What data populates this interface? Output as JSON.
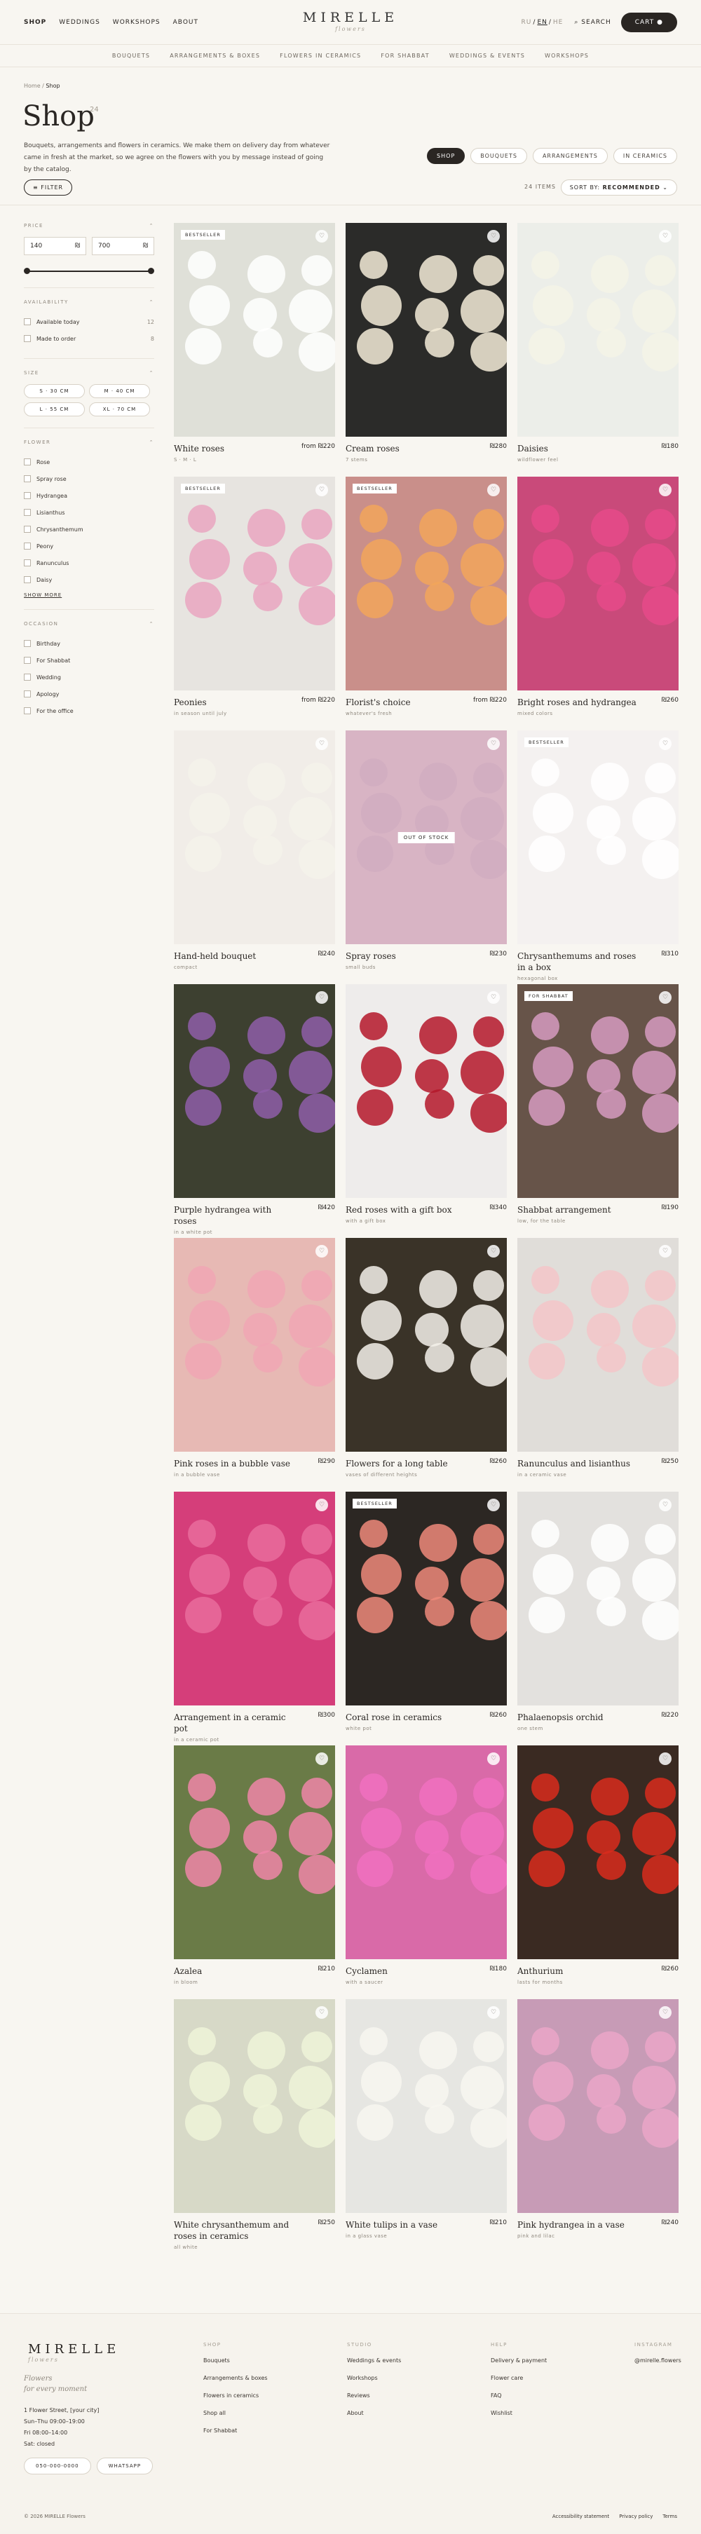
{
  "header": {
    "nav": [
      "SHOP",
      "WEDDINGS",
      "WORKSHOPS",
      "ABOUT"
    ],
    "logo": "MIRELLE",
    "logo_sub": "flowers",
    "lang": [
      "RU",
      "EN",
      "HE"
    ],
    "search": "SEARCH",
    "cart": "CART"
  },
  "categories": [
    "BOUQUETS",
    "ARRANGEMENTS & BOXES",
    "FLOWERS IN CERAMICS",
    "FOR SHABBAT",
    "WEDDINGS & EVENTS",
    "WORKSHOPS"
  ],
  "breadcrumb": {
    "home": "Home",
    "sep": "/",
    "current": "Shop"
  },
  "page": {
    "title": "Shop",
    "count": "24",
    "intro": "Bouquets, arrangements and flowers in ceramics. We make them on delivery day from whatever came in fresh at the market, so we agree on the flowers with you by message instead of going by the catalog."
  },
  "tabs": [
    "SHOP",
    "BOUQUETS",
    "ARRANGEMENTS",
    "IN CERAMICS"
  ],
  "toolbar": {
    "filter": "FILTER",
    "items": "24 ITEMS",
    "sort_label": "SORT BY:",
    "sort_value": "RECOMMENDED"
  },
  "filters": {
    "price": {
      "title": "PRICE",
      "min": "140",
      "max": "700",
      "cur": "₪",
      "min_val": 140,
      "max_val": 700
    },
    "availability": {
      "title": "AVAILABILITY",
      "options": [
        {
          "label": "Available today",
          "count": "12"
        },
        {
          "label": "Made to order",
          "count": "8"
        }
      ]
    },
    "size": {
      "title": "SIZE",
      "options": [
        "S · 30 CM",
        "M · 40 CM",
        "L · 55 CM",
        "XL · 70 CM"
      ]
    },
    "flower": {
      "title": "FLOWER",
      "options": [
        "Rose",
        "Spray rose",
        "Hydrangea",
        "Lisianthus",
        "Chrysanthemum",
        "Peony",
        "Ranunculus",
        "Daisy"
      ],
      "more": "SHOW MORE"
    },
    "occasion": {
      "title": "OCCASION",
      "options": [
        "Birthday",
        "For Shabbat",
        "Wedding",
        "Apology",
        "For the office"
      ]
    }
  },
  "products": [
    {
      "name": "White roses",
      "price": "from ₪220",
      "desc": "S · M · L",
      "badge": "BESTSELLER"
    },
    {
      "name": "Cream roses",
      "price": "₪280",
      "desc": "7 stems",
      "badge": ""
    },
    {
      "name": "Daisies",
      "price": "₪180",
      "desc": "wildflower feel",
      "badge": ""
    },
    {
      "name": "Peonies",
      "price": "from ₪220",
      "desc": "in season until july",
      "badge": "BESTSELLER"
    },
    {
      "name": "Florist's choice",
      "price": "from ₪220",
      "desc": "whatever's fresh",
      "badge": "BESTSELLER"
    },
    {
      "name": "Bright roses and hydrangea",
      "price": "₪260",
      "desc": "mixed colors",
      "badge": ""
    },
    {
      "name": "Hand-held bouquet",
      "price": "₪240",
      "desc": "compact",
      "badge": ""
    },
    {
      "name": "Spray roses",
      "price": "₪230",
      "desc": "small buds",
      "badge": "",
      "oos": "OUT OF STOCK"
    },
    {
      "name": "Chrysanthemums and roses in a box",
      "price": "₪310",
      "desc": "hexagonal box",
      "badge": "BESTSELLER"
    },
    {
      "name": "Purple hydrangea with roses",
      "price": "₪420",
      "desc": "in a white pot",
      "badge": ""
    },
    {
      "name": "Red roses with a gift box",
      "price": "₪340",
      "desc": "with a gift box",
      "badge": ""
    },
    {
      "name": "Shabbat arrangement",
      "price": "₪190",
      "desc": "low, for the table",
      "badge": "FOR SHABBAT"
    },
    {
      "name": "Pink roses in a bubble vase",
      "price": "₪290",
      "desc": "in a bubble vase",
      "badge": ""
    },
    {
      "name": "Flowers for a long table",
      "price": "₪260",
      "desc": "vases of different heights",
      "badge": ""
    },
    {
      "name": "Ranunculus and lisianthus",
      "price": "₪250",
      "desc": "in a ceramic vase",
      "badge": ""
    },
    {
      "name": "Arrangement in a ceramic pot",
      "price": "₪300",
      "desc": "in a ceramic pot",
      "badge": ""
    },
    {
      "name": "Coral rose in ceramics",
      "price": "₪260",
      "desc": "white pot",
      "badge": "BESTSELLER"
    },
    {
      "name": "Phalaenopsis orchid",
      "price": "₪220",
      "desc": "one stem",
      "badge": ""
    },
    {
      "name": "Azalea",
      "price": "₪210",
      "desc": "in bloom",
      "badge": ""
    },
    {
      "name": "Cyclamen",
      "price": "₪180",
      "desc": "with a saucer",
      "badge": ""
    },
    {
      "name": "Anthurium",
      "price": "₪260",
      "desc": "lasts for months",
      "badge": ""
    },
    {
      "name": "White chrysanthemum and roses in ceramics",
      "price": "₪250",
      "desc": "all white",
      "badge": ""
    },
    {
      "name": "White tulips in a vase",
      "price": "₪210",
      "desc": "in a glass vase",
      "badge": ""
    },
    {
      "name": "Pink hydrangea in a vase",
      "price": "₪240",
      "desc": "pink and lilac",
      "badge": ""
    }
  ],
  "footer": {
    "logo": "MIRELLE",
    "logo_sub": "flowers",
    "tagline": [
      "Flowers",
      "for every moment"
    ],
    "address": [
      "1 Flower Street, [your city]",
      "Sun–Thu 09:00–19:00",
      "Fri 08:00–14:00",
      "Sat: closed"
    ],
    "buttons": [
      "050-000-0000",
      "WHATSAPP"
    ],
    "columns": [
      {
        "title": "SHOP",
        "links": [
          "Bouquets",
          "Arrangements & boxes",
          "Flowers in ceramics",
          "Shop all",
          "For Shabbat"
        ]
      },
      {
        "title": "STUDIO",
        "links": [
          "Weddings & events",
          "Workshops",
          "Reviews",
          "About"
        ]
      },
      {
        "title": "HELP",
        "links": [
          "Delivery & payment",
          "Flower care",
          "FAQ",
          "Wishlist"
        ]
      },
      {
        "title": "INSTAGRAM",
        "links": [
          "@mirelle.flowers"
        ]
      }
    ],
    "copyright": "© 2026 MIRELLE Flowers",
    "legal": [
      "Accessibility statement",
      "Privacy policy",
      "Terms"
    ]
  },
  "colors": {
    "bg": "#f8f6f1",
    "ink": "#2a2623",
    "muted": "#8f887e"
  }
}
